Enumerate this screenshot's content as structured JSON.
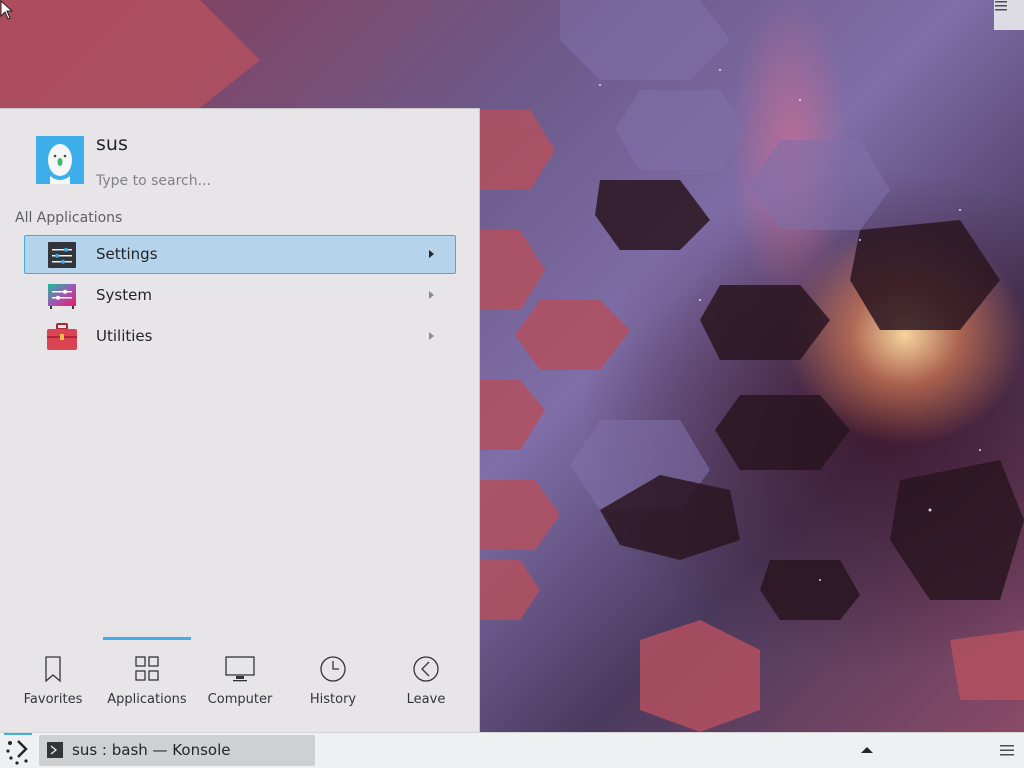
{
  "user": {
    "name": "sus"
  },
  "search": {
    "placeholder": "Type to search..."
  },
  "section": {
    "title": "All Applications"
  },
  "apps": [
    {
      "label": "Settings",
      "icon": "settings-icon",
      "selected": true
    },
    {
      "label": "System",
      "icon": "system-icon",
      "selected": false
    },
    {
      "label": "Utilities",
      "icon": "utilities-icon",
      "selected": false
    }
  ],
  "tabs": [
    {
      "label": "Favorites",
      "icon": "bookmark-icon"
    },
    {
      "label": "Applications",
      "icon": "grid-icon",
      "active": true
    },
    {
      "label": "Computer",
      "icon": "monitor-icon"
    },
    {
      "label": "History",
      "icon": "clock-icon"
    },
    {
      "label": "Leave",
      "icon": "back-arrow-icon"
    }
  ],
  "taskbar": {
    "tasks": [
      {
        "label": "sus : bash — Konsole",
        "icon": "terminal-icon"
      }
    ]
  },
  "colors": {
    "accent": "#3daee9",
    "selection": "#b5d3ea",
    "panel": "#eff0f1"
  }
}
